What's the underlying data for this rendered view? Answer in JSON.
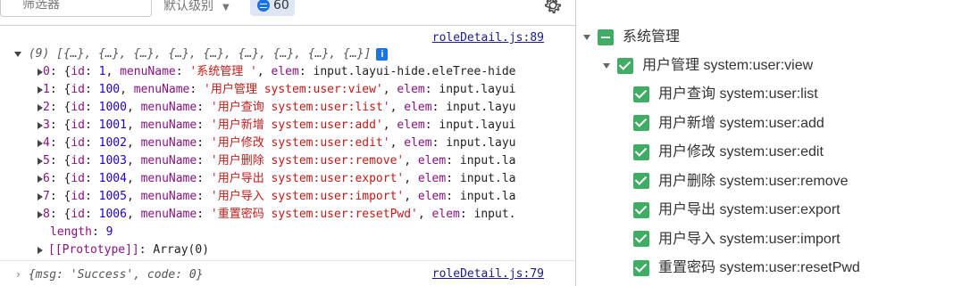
{
  "console": {
    "filter_placeholder": "筛选器",
    "level_label": "默认级别",
    "message_count": "60",
    "array_summary": "(9) [{…}, {…}, {…}, {…}, {…}, {…}, {…}, {…}, {…}]",
    "info_badge": "i",
    "source1": "roleDetail.js:89",
    "rows": [
      {
        "idx": "0",
        "id": "1",
        "menuName": "'系统管理 '",
        "elem": "input.layui-hide.eleTree-hide"
      },
      {
        "idx": "1",
        "id": "100",
        "menuName": "'用户管理 system:user:view'",
        "elem": "input.layui"
      },
      {
        "idx": "2",
        "id": "1000",
        "menuName": "'用户查询 system:user:list'",
        "elem": "input.layu"
      },
      {
        "idx": "3",
        "id": "1001",
        "menuName": "'用户新增 system:user:add'",
        "elem": "input.layui"
      },
      {
        "idx": "4",
        "id": "1002",
        "menuName": "'用户修改 system:user:edit'",
        "elem": "input.layu"
      },
      {
        "idx": "5",
        "id": "1003",
        "menuName": "'用户删除 system:user:remove'",
        "elem": "input.la"
      },
      {
        "idx": "6",
        "id": "1004",
        "menuName": "'用户导出 system:user:export'",
        "elem": "input.la"
      },
      {
        "idx": "7",
        "id": "1005",
        "menuName": "'用户导入 system:user:import'",
        "elem": "input.la"
      },
      {
        "idx": "8",
        "id": "1006",
        "menuName": "'重置密码 system:user:resetPwd'",
        "elem": "input."
      }
    ],
    "length_key": "length",
    "length_val": "9",
    "prototype_key": "[[Prototype]]",
    "prototype_val": "Array(0)",
    "response": "{msg: 'Success', code: 0}",
    "source2": "roleDetail.js:79"
  },
  "tree": {
    "root": "系统管理",
    "child": "用户管理 system:user:view",
    "leaves": [
      "用户查询 system:user:list",
      "用户新增 system:user:add",
      "用户修改 system:user:edit",
      "用户删除 system:user:remove",
      "用户导出 system:user:export",
      "用户导入 system:user:import",
      "重置密码 system:user:resetPwd"
    ]
  },
  "colors": {
    "checkbox_green": "#3fae64",
    "link_blue": "#1a1a8c",
    "string_red": "#c41a16",
    "key_purple": "#881280",
    "number_blue": "#1c00cf"
  }
}
